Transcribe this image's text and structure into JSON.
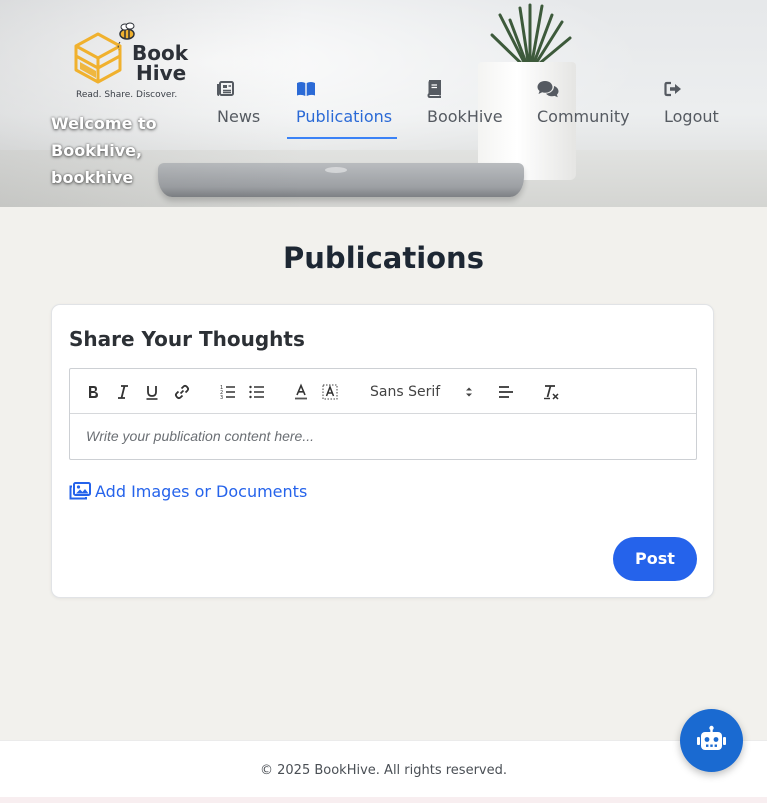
{
  "header": {
    "logo": {
      "name_line1": "Book",
      "name_line2": "Hive",
      "tagline": "Read. Share. Discover."
    },
    "welcome": "Welcome to BookHive, bookhive",
    "nav": [
      {
        "label": "News",
        "icon": "newspaper-icon"
      },
      {
        "label": "Publications",
        "icon": "open-book-icon",
        "active": true
      },
      {
        "label": "BookHive",
        "icon": "book-icon"
      },
      {
        "label": "Community",
        "icon": "chat-bubbles-icon"
      },
      {
        "label": "Logout",
        "icon": "sign-out-icon"
      }
    ]
  },
  "main": {
    "title": "Publications",
    "card": {
      "title": "Share Your Thoughts",
      "editor": {
        "toolbar": {
          "buttons": [
            "bold",
            "italic",
            "underline",
            "link",
            "ordered-list",
            "bullet-list",
            "text-color",
            "background-color",
            "align",
            "clear-formatting"
          ],
          "font_select": "Sans Serif"
        },
        "placeholder": "Write your publication content here..."
      },
      "attach_label": "Add Images or Documents",
      "post_label": "Post"
    }
  },
  "footer": {
    "text": "© 2025 BookHive. All rights reserved."
  },
  "colors": {
    "accent": "#2563eb",
    "nav_active": "#2b6ad6",
    "chatbot": "#1a6ad1"
  }
}
